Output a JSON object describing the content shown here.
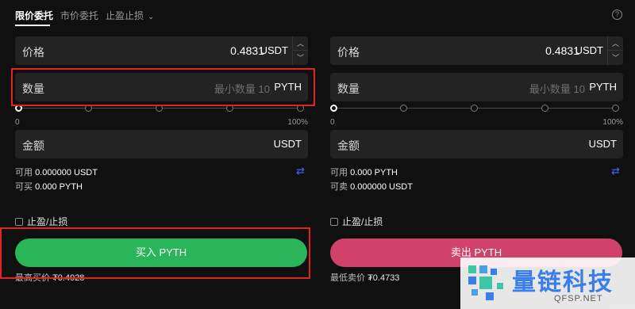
{
  "tabs": [
    {
      "label": "限价委托",
      "active": true
    },
    {
      "label": "市价委托",
      "active": false
    },
    {
      "label": "止盈止损",
      "active": false
    }
  ],
  "help_icon": "question-circle-icon",
  "buy": {
    "price_label": "价格",
    "price_value": "0.4831",
    "price_unit": "USDT",
    "qty_label": "数量",
    "qty_placeholder": "最小数量 10",
    "qty_unit": "PYTH",
    "slider_min": "0",
    "slider_max": "100%",
    "slider_value": 0,
    "amount_label": "金额",
    "amount_unit": "USDT",
    "available_label": "可用",
    "available_value": "0.000000 USDT",
    "can_buy_label": "可买",
    "can_buy_value": "0.000 PYTH",
    "tpsl_label": "止盈/止损",
    "button": "买入 PYTH",
    "best_label": "最高买价",
    "best_value": "₮0.4928"
  },
  "sell": {
    "price_label": "价格",
    "price_value": "0.4831",
    "price_unit": "USDT",
    "qty_label": "数量",
    "qty_placeholder": "最小数量 10",
    "qty_unit": "PYTH",
    "slider_min": "0",
    "slider_max": "100%",
    "slider_value": 0,
    "amount_label": "金额",
    "amount_unit": "USDT",
    "available_label": "可用",
    "available_value": "0.000 PYTH",
    "can_sell_label": "可卖",
    "can_sell_value": "0.000000 USDT",
    "tpsl_label": "止盈/止损",
    "button": "卖出 PYTH",
    "best_label": "最低卖价",
    "best_value": "₮0.4733"
  },
  "colors": {
    "buy": "#2ab55a",
    "sell": "#d0426a",
    "highlight": "#e0241f",
    "swap": "#3d6bff"
  },
  "watermark": {
    "text": "量链科技",
    "sub": "QFSP.NET"
  }
}
